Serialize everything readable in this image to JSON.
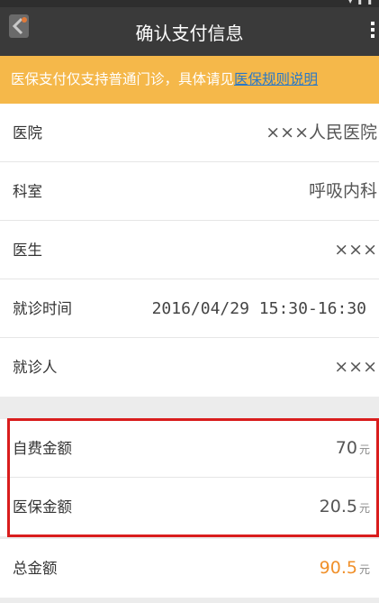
{
  "header": {
    "title": "确认支付信息",
    "back_icon": "back-arrow-icon",
    "more_icon": "more-vertical-icon"
  },
  "notice": {
    "text": "医保支付仅支持普通门诊，具体请见",
    "link": "医保规则说明"
  },
  "info": {
    "hospital_label": "医院",
    "hospital_value": "×××人民医院",
    "department_label": "科室",
    "department_value": "呼吸内科",
    "doctor_label": "医生",
    "doctor_value": "×××",
    "visit_time_label": "就诊时间",
    "visit_time_value": "2016/04/29  15:30-16:30",
    "patient_label": "就诊人",
    "patient_value": "×××"
  },
  "payment": {
    "self_pay_label": "自费金额",
    "self_pay_amount": "70",
    "insurance_label": "医保金额",
    "insurance_amount": "20.5",
    "total_label": "总金额",
    "total_amount": "90.5",
    "currency": "元"
  },
  "colors": {
    "notice_bg": "#f5b84a",
    "link": "#2a78c6",
    "total_amount": "#f0902a",
    "highlight_border": "#d91d1d"
  }
}
